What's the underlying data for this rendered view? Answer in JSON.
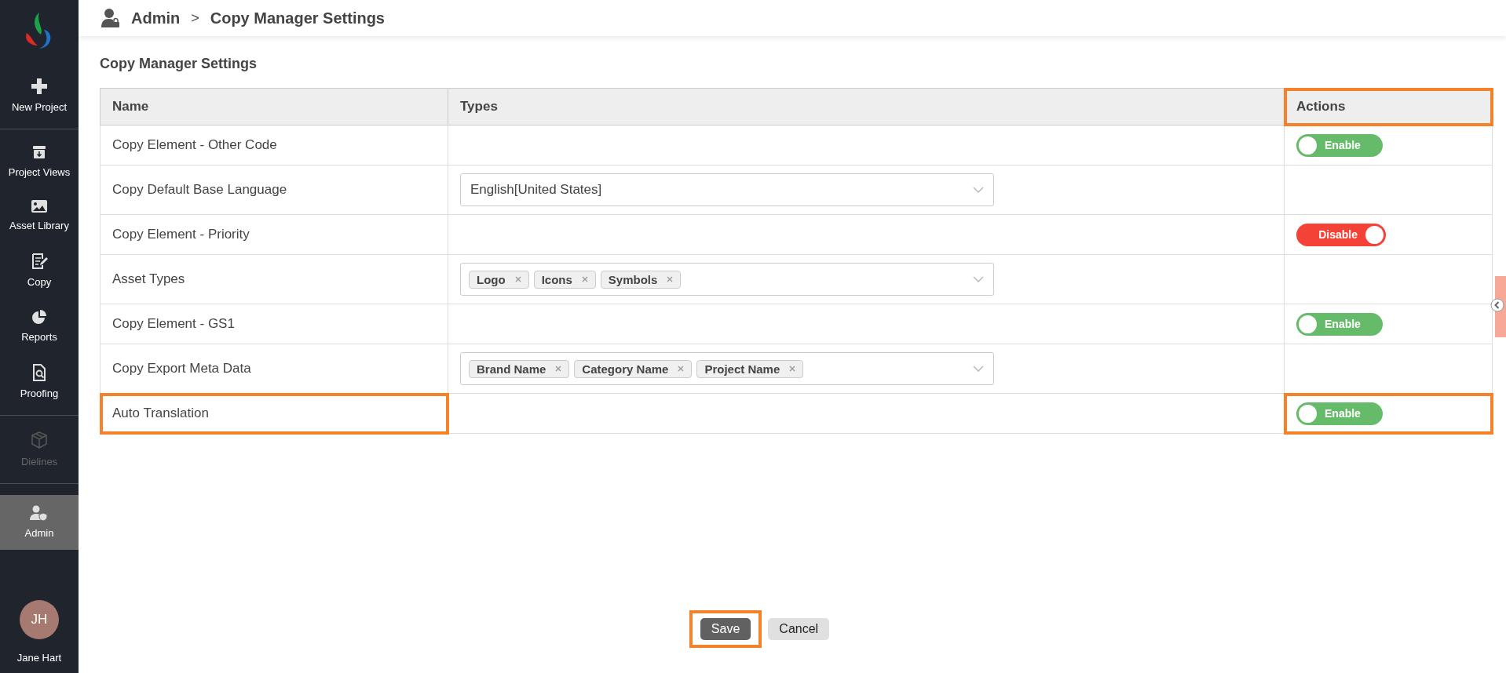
{
  "sidebar": {
    "groups": [
      [
        {
          "label": "New Project",
          "selected": false,
          "disabled": false
        }
      ],
      [
        {
          "label": "Project Views",
          "selected": false,
          "disabled": false
        },
        {
          "label": "Asset Library",
          "selected": false,
          "disabled": false
        },
        {
          "label": "Copy",
          "selected": false,
          "disabled": false
        },
        {
          "label": "Reports",
          "selected": false,
          "disabled": false
        },
        {
          "label": "Proofing",
          "selected": false,
          "disabled": false
        }
      ],
      [
        {
          "label": "Dielines",
          "selected": false,
          "disabled": true
        }
      ],
      [
        {
          "label": "Admin",
          "selected": true,
          "disabled": false
        }
      ]
    ],
    "user": {
      "initials": "JH",
      "name": "Jane Hart"
    }
  },
  "breadcrumb": [
    "Admin",
    ">",
    "Copy Manager Settings"
  ],
  "page_title": "Copy Manager Settings",
  "table": {
    "columns": [
      {
        "label": "Name",
        "highlighted": false
      },
      {
        "label": "Types",
        "highlighted": false
      },
      {
        "label": "Actions",
        "highlighted": true
      }
    ],
    "rows": [
      {
        "name": "Copy Element - Other Code",
        "kind": "toggle",
        "on": true,
        "toggle_label": "Enable",
        "highlighted": false
      },
      {
        "name": "Copy Default Base Language",
        "kind": "select",
        "value": "English[United States]",
        "highlighted": false
      },
      {
        "name": "Copy Element - Priority",
        "kind": "toggle",
        "on": false,
        "toggle_label": "Disable",
        "highlighted": false
      },
      {
        "name": "Asset Types",
        "kind": "multiselect",
        "tags": [
          "Logo",
          "Icons",
          "Symbols"
        ],
        "highlighted": false
      },
      {
        "name": "Copy Element - GS1",
        "kind": "toggle",
        "on": true,
        "toggle_label": "Enable",
        "highlighted": false
      },
      {
        "name": "Copy Export Meta Data",
        "kind": "multiselect",
        "tags": [
          "Brand Name",
          "Category Name",
          "Project Name"
        ],
        "highlighted": false
      },
      {
        "name": "Auto Translation",
        "kind": "toggle",
        "on": true,
        "toggle_label": "Enable",
        "highlighted": true
      }
    ]
  },
  "buttons": [
    {
      "label": "Save",
      "kind": "primary",
      "highlighted": true
    },
    {
      "label": "Cancel",
      "kind": "secondary",
      "highlighted": false
    }
  ]
}
